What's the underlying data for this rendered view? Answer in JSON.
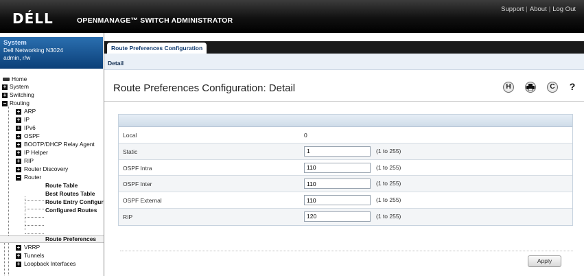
{
  "header": {
    "logo": "DÉLL",
    "product": "OPENMANAGE™ SWITCH ADMINISTRATOR",
    "links": [
      "Support",
      "About",
      "Log Out"
    ]
  },
  "system": {
    "title": "System",
    "model": "Dell Networking N3024",
    "user": "admin, r/w"
  },
  "tree": {
    "home": "Home",
    "system": "System",
    "switching": "Switching",
    "routing": "Routing",
    "arp": "ARP",
    "ip": "IP",
    "ipv6": "IPv6",
    "ospf": "OSPF",
    "bootp": "BOOTP/DHCP Relay Agent",
    "iphelper": "IP Helper",
    "rip": "RIP",
    "routerdiscovery": "Router Discovery",
    "router": "Router",
    "routetable": "Route Table",
    "bestroutes": "Best Routes Table",
    "routeentry": "Route Entry Configuration",
    "configuredroutes": "Configured Routes",
    "routeprefs": "Route Preferences",
    "vrrp": "VRRP",
    "tunnels": "Tunnels",
    "loopback": "Loopback Interfaces"
  },
  "tabs": {
    "main": "Route Preferences Configuration",
    "sub": "Detail"
  },
  "page": {
    "title": "Route Preferences Configuration: Detail"
  },
  "toolbar": {
    "icons": [
      "h-help-icon",
      "print-icon",
      "refresh-icon",
      "question-icon"
    ],
    "h": "H",
    "refresh": "C",
    "question": "?"
  },
  "form": {
    "rows": [
      {
        "label": "Local",
        "value": "0"
      },
      {
        "label": "Static",
        "value": "1",
        "range": "(1 to 255)"
      },
      {
        "label": "OSPF Intra",
        "value": "110",
        "range": "(1 to 255)"
      },
      {
        "label": "OSPF Inter",
        "value": "110",
        "range": "(1 to 255)"
      },
      {
        "label": "OSPF External",
        "value": "110",
        "range": "(1 to 255)"
      },
      {
        "label": "RIP",
        "value": "120",
        "range": "(1 to 255)"
      }
    ]
  },
  "actions": {
    "apply": "Apply"
  },
  "colors": {
    "header": "#000000",
    "system_box": "#1a5a9a",
    "table_header": "#d6e2ee"
  }
}
